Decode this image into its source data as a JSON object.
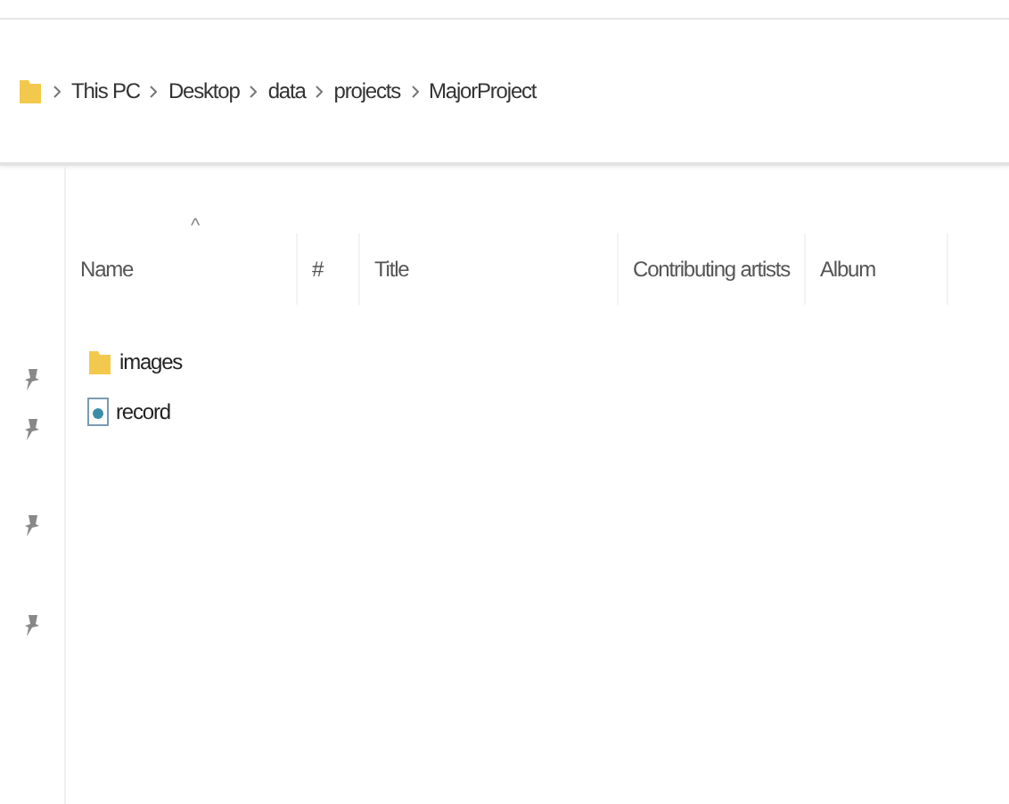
{
  "breadcrumb": [
    "This PC",
    "Desktop",
    "data",
    "projects",
    "MajorProject"
  ],
  "table": {
    "sort_indicator": "^",
    "columns": [
      "Name",
      "#",
      "Title",
      "Contributing artists",
      "Album"
    ],
    "rows": [
      {
        "name": "images",
        "kind": "folder"
      },
      {
        "name": "record",
        "kind": "file"
      }
    ]
  }
}
